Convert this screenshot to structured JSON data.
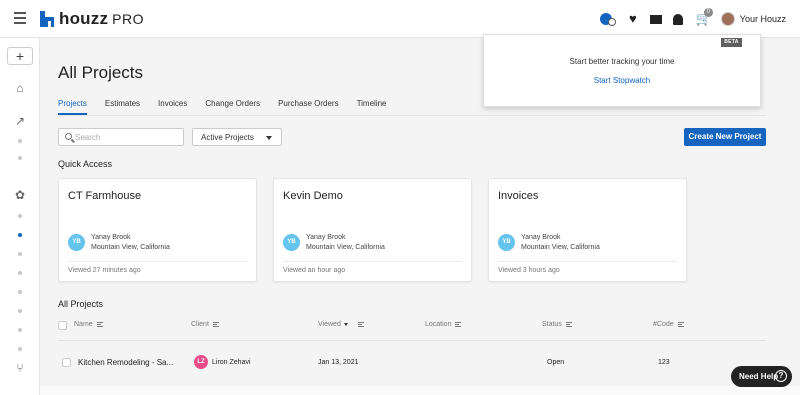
{
  "header": {
    "logo_text": "houzz",
    "logo_pro": "PRO",
    "user_name": "Your Houzz",
    "cart_count": "0"
  },
  "rail": {
    "plus_label": "+"
  },
  "page": {
    "title": "All Projects",
    "tabs": [
      {
        "label": "Projects",
        "active": true
      },
      {
        "label": "Estimates"
      },
      {
        "label": "Invoices"
      },
      {
        "label": "Change Orders"
      },
      {
        "label": "Purchase Orders"
      },
      {
        "label": "Timeline"
      }
    ]
  },
  "toolbar": {
    "search_placeholder": "Search",
    "filter_value": "Active Projects",
    "create_label": "Create New Project"
  },
  "quick_access": {
    "label": "Quick Access",
    "cards": [
      {
        "title": "CT Farmhouse",
        "initials": "YB",
        "owner": "Yanay Brook",
        "location": "Mountain View, California",
        "viewed": "Viewed 27 minutes ago"
      },
      {
        "title": "Kevin Demo",
        "initials": "YB",
        "owner": "Yanay Brook",
        "location": "Mountain View, California",
        "viewed": "Viewed an hour ago"
      },
      {
        "title": "Invoices",
        "initials": "YB",
        "owner": "Yanay Brook",
        "location": "Mountain View, California",
        "viewed": "Viewed 3 hours ago"
      }
    ]
  },
  "all_projects": {
    "label": "All Projects",
    "columns": [
      "Name",
      "Client",
      "Viewed",
      "Location",
      "Status",
      "#Code"
    ],
    "rows": [
      {
        "name": "Kitchen Remodeling - Sa...",
        "client_initials": "LZ",
        "client": "Liron Zehavi",
        "viewed": "Jan 13, 2021",
        "location": "",
        "status": "Open",
        "code": "123"
      }
    ]
  },
  "popover": {
    "badge": "BETA",
    "text": "Start better tracking your time",
    "link": "Start Stopwatch"
  },
  "help": {
    "label": "Need Help",
    "icon": "?"
  },
  "colors": {
    "brand": "#1565c0",
    "avatar_blue": "#64c4ee",
    "avatar_pink": "#e84d8a"
  }
}
